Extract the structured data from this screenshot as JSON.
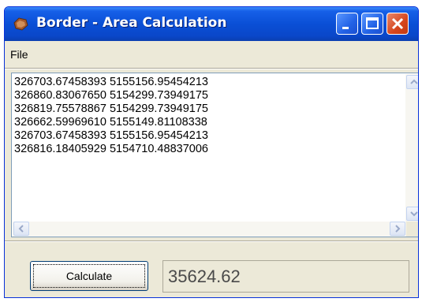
{
  "window": {
    "title": "Border - Area Calculation",
    "icon": "map-shape-icon"
  },
  "menu": {
    "items": [
      {
        "label": "File"
      }
    ]
  },
  "coordinates_text": "326703.67458393 5155156.95454213\n326860.83067650 5154299.73949175\n326819.75578867 5154299.73949175\n326662.59969610 5155149.81108338\n326703.67458393 5155156.95454213\n326816.18405929 5154710.48837006",
  "actions": {
    "calculate_label": "Calculate"
  },
  "result": {
    "area": "35624.62"
  },
  "colors": {
    "titlebar_blue": "#0a4fd6",
    "close_red": "#d5451d",
    "window_bg": "#ece9d8"
  }
}
